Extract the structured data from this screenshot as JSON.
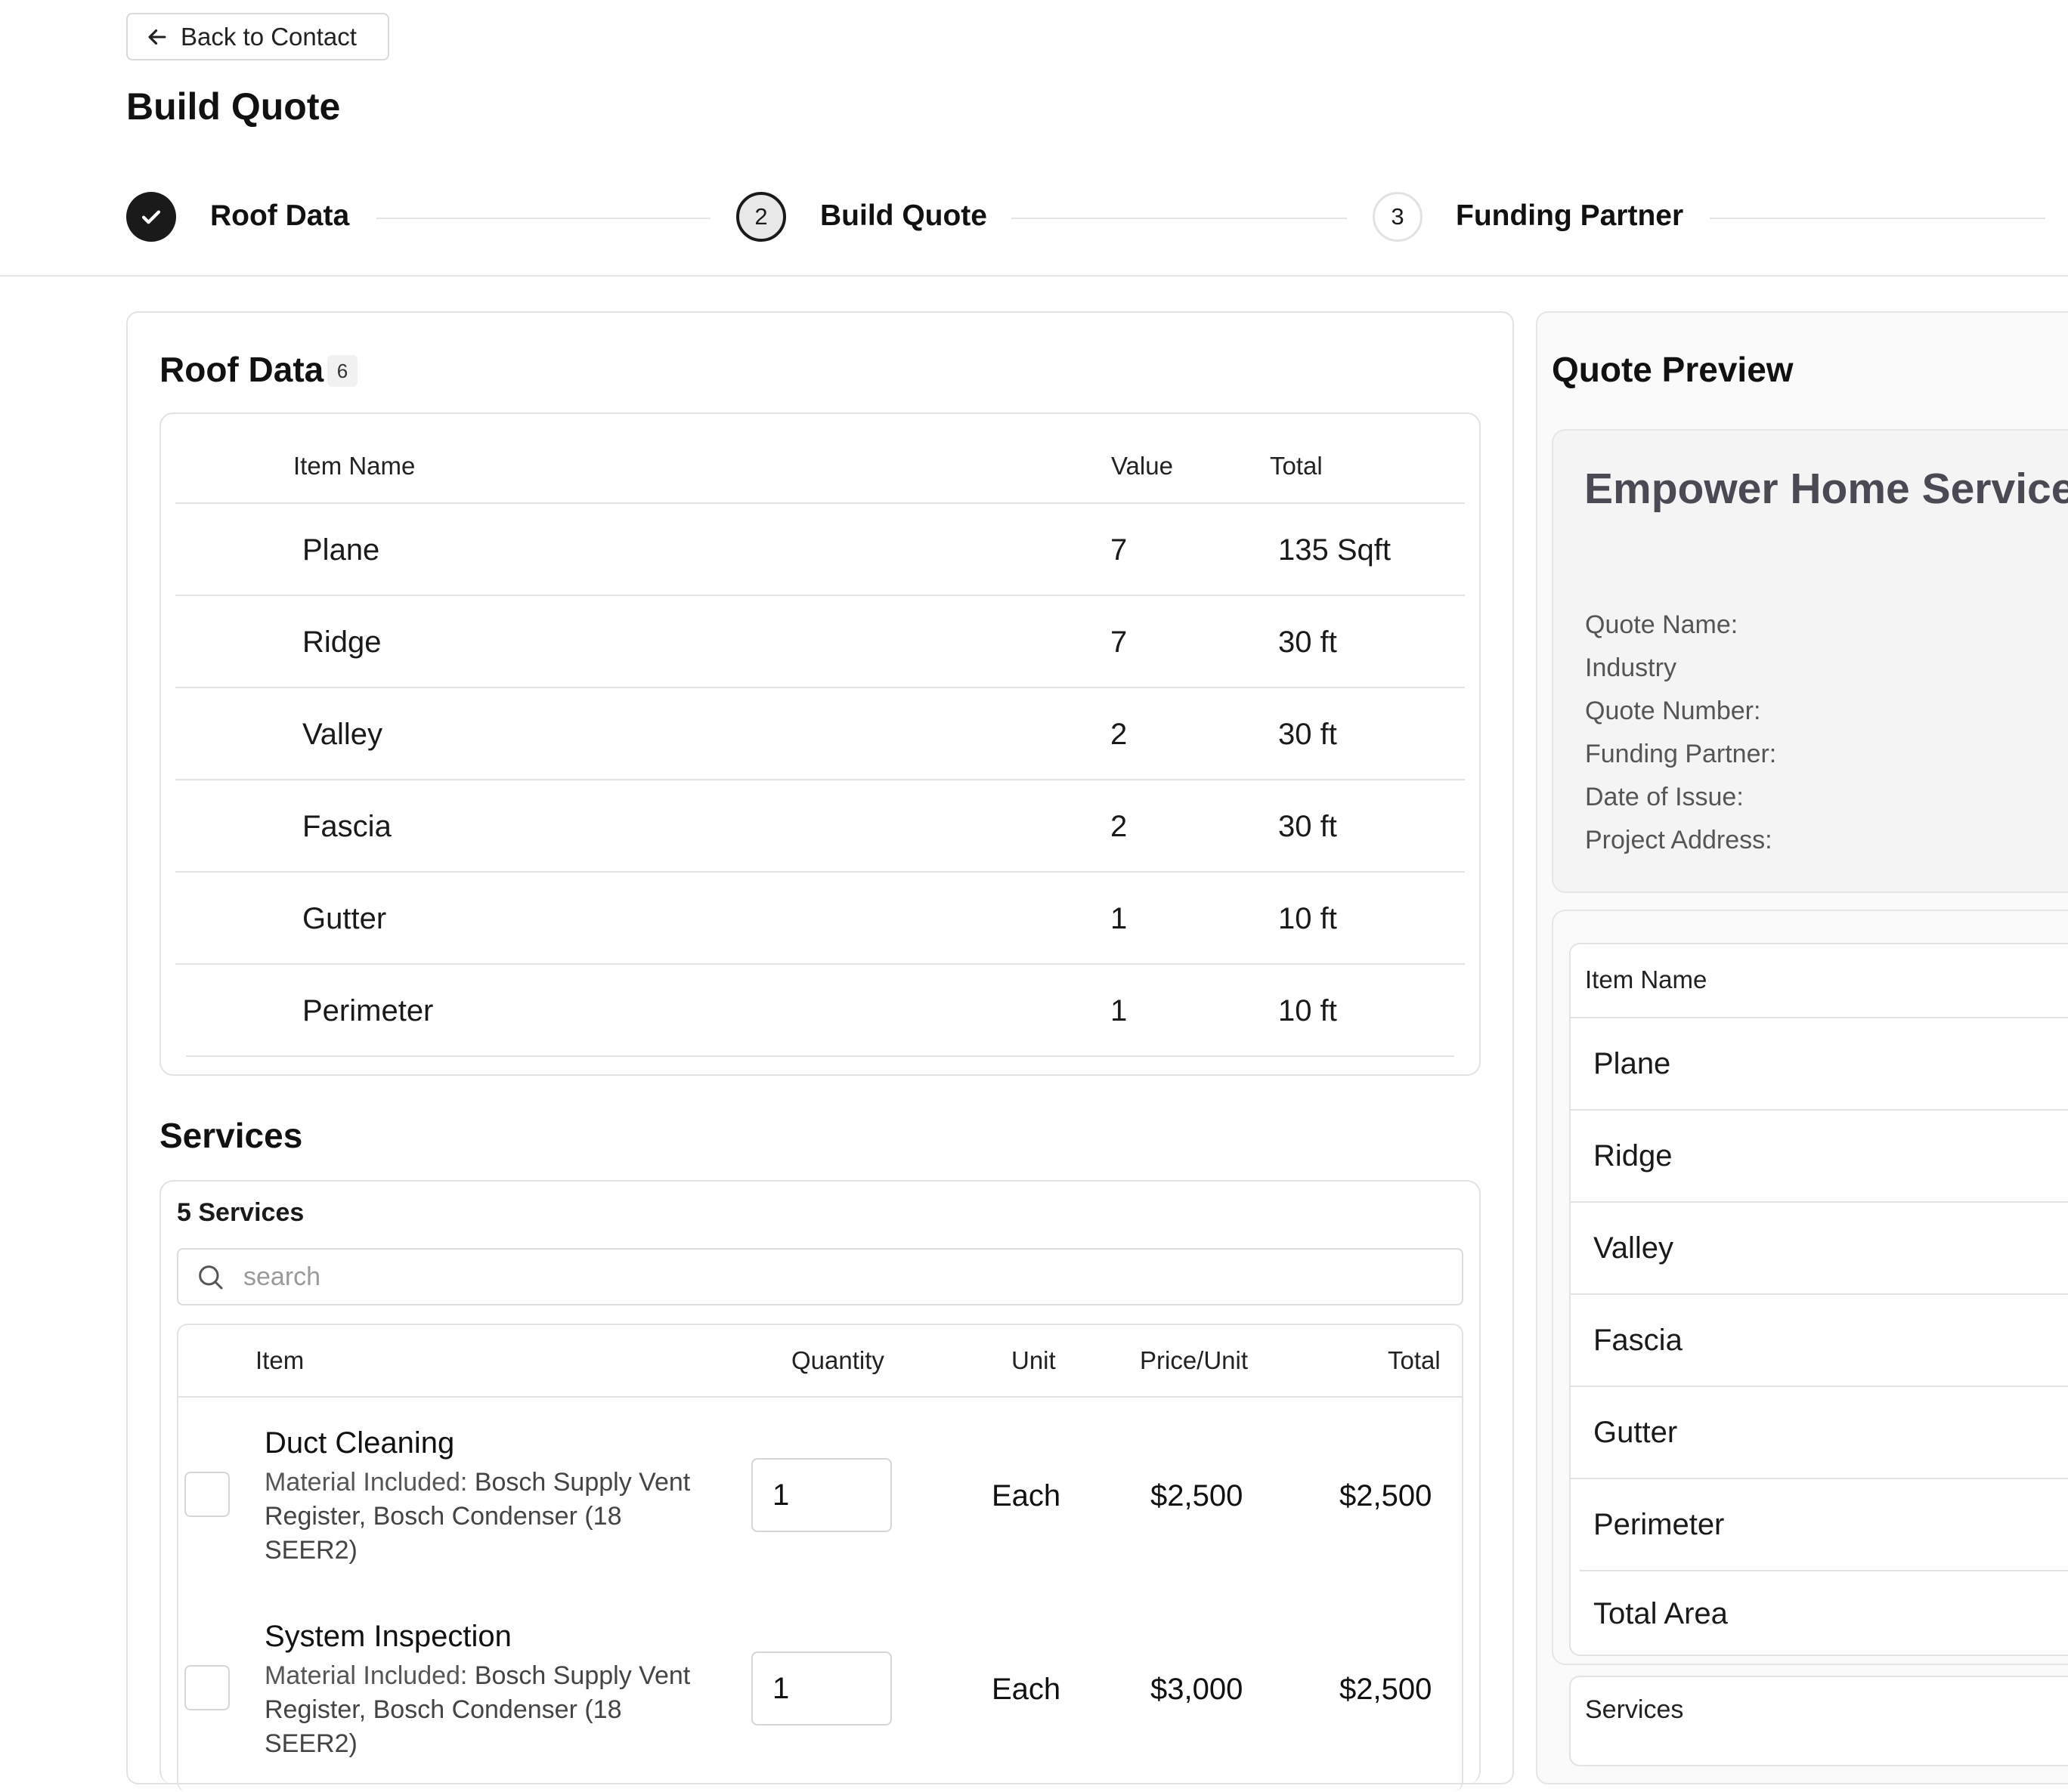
{
  "header": {
    "back_label": "Back to Contact",
    "page_title": "Build Quote"
  },
  "stepper": {
    "steps": [
      {
        "number": "",
        "label": "Roof Data",
        "state": "complete"
      },
      {
        "number": "2",
        "label": "Build Quote",
        "state": "current"
      },
      {
        "number": "3",
        "label": "Funding Partner",
        "state": "upcoming"
      }
    ]
  },
  "roof_data": {
    "title": "Roof Data",
    "count": "6",
    "columns": [
      "Item Name",
      "Value",
      "Total"
    ],
    "rows": [
      {
        "name": "Plane",
        "value": "7",
        "total": "135 Sqft"
      },
      {
        "name": "Ridge",
        "value": "7",
        "total": "30 ft"
      },
      {
        "name": "Valley",
        "value": "2",
        "total": "30 ft"
      },
      {
        "name": "Fascia",
        "value": "2",
        "total": "30 ft"
      },
      {
        "name": "Gutter",
        "value": "1",
        "total": "10 ft"
      },
      {
        "name": "Perimeter",
        "value": "1",
        "total": "10 ft"
      }
    ]
  },
  "services": {
    "title": "Services",
    "count_label": "5 Services",
    "search_placeholder": "search",
    "columns": [
      "Item",
      "Quantity",
      "Unit",
      "Price/Unit",
      "Total"
    ],
    "rows": [
      {
        "name": "Duct Cleaning",
        "material_prefix": "Material Included: ",
        "material_line1": "Bosch Supply Vent",
        "material_line2": "Register, Bosch  Condenser (18",
        "material_line3": "SEER2)",
        "quantity": "1",
        "unit": "Each",
        "price": "$2,500",
        "total": "$2,500"
      },
      {
        "name": "System Inspection",
        "material_prefix": "Material Included: ",
        "material_line1": "Bosch Supply Vent",
        "material_line2": "Register, Bosch  Condenser (18",
        "material_line3": "SEER2)",
        "quantity": "1",
        "unit": "Each",
        "price": "$3,000",
        "total": "$2,500"
      }
    ]
  },
  "quote_preview": {
    "title": "Quote Preview",
    "company_name": "Empower Home Services",
    "meta": [
      "Quote Name:",
      "Industry",
      "Quote Number:",
      "Funding Partner:",
      "Date of Issue:",
      "Project Address:"
    ],
    "items_header": "Item Name",
    "items": [
      "Plane",
      "Ridge",
      "Valley",
      "Fascia",
      "Gutter",
      "Perimeter",
      "Total Area"
    ],
    "services_label": "Services"
  },
  "icons": {
    "back": "arrow-left-icon",
    "step_complete": "check-icon",
    "search": "search-icon"
  },
  "colors": {
    "step_complete_bg": "#1a1a1a",
    "current_step_bg": "#e8e8e8",
    "company_name": "#4a4a55"
  }
}
